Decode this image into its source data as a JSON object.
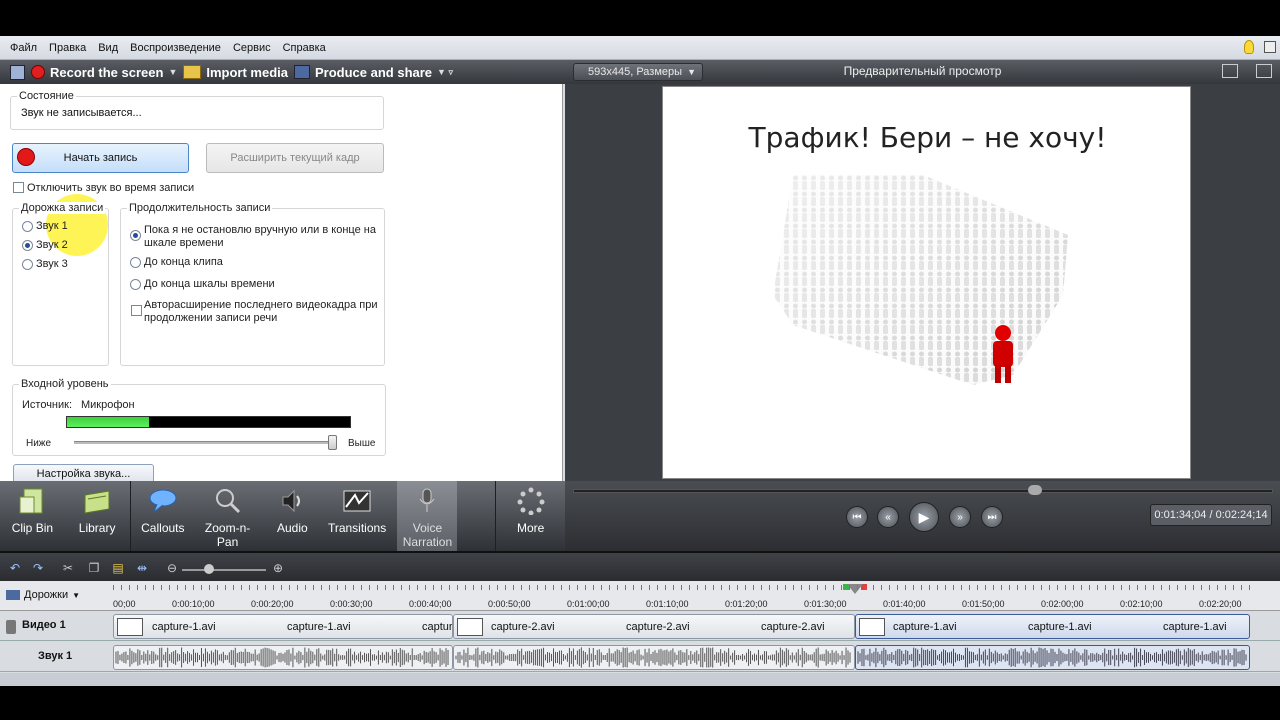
{
  "menu": [
    "Файл",
    "Правка",
    "Вид",
    "Воспроизведение",
    "Сервис",
    "Справка"
  ],
  "toolbar": {
    "record": "Record the screen",
    "import": "Import media",
    "produce": "Produce and share"
  },
  "voice_panel": {
    "status_legend": "Состояние",
    "status_text": "Звук не записывается...",
    "start_button": "Начать запись",
    "extend_button": "Расширить текущий кадр",
    "mute_checkbox": "Отключить звук во время записи",
    "track_legend": "Дорожка записи",
    "tracks": [
      "Звук 1",
      "Звук 2",
      "Звук 3"
    ],
    "selected_track": "Звук 2",
    "duration_legend": "Продолжительность записи",
    "duration_options": [
      "Пока я не остановлю вручную или в конце на шкале времени",
      "До конца клипа",
      "До конца шкалы времени"
    ],
    "autoextend": "Авторасширение последнего видеокадра при продолжении записи речи",
    "input_legend": "Входной уровень",
    "source_label": "Источник:",
    "source_value": "Микрофон",
    "level_fraction": 0.29,
    "low_label": "Ниже",
    "high_label": "Выше",
    "volume_fraction": 0.99,
    "settings_button": "Настройка звука..."
  },
  "tool_tabs": [
    {
      "label": "Clip Bin",
      "icon": "clip-bin-icon"
    },
    {
      "label": "Library",
      "icon": "library-icon"
    },
    {
      "label": "Callouts",
      "icon": "callouts-icon"
    },
    {
      "label": "Zoom-n-Pan",
      "icon": "zoom-icon"
    },
    {
      "label": "Audio",
      "icon": "speaker-icon"
    },
    {
      "label": "Transitions",
      "icon": "transitions-icon"
    },
    {
      "label": "Voice Narration",
      "icon": "microphone-icon"
    },
    {
      "label": "More",
      "icon": "more-icon"
    }
  ],
  "preview": {
    "size_dropdown": "593x445, Размеры",
    "title": "Предварительный просмотр",
    "slide_title": "Трафик! Бери – не хочу!",
    "timecode": "0:01:34;04 / 0:02:24;14",
    "position_fraction": 0.65
  },
  "timeline": {
    "tracks_label": "Дорожки",
    "ticks": [
      "00;00",
      "0:00:10;00",
      "0:00:20;00",
      "0:00:30;00",
      "0:00:40;00",
      "0:00:50;00",
      "0:01:00;00",
      "0:01:10;00",
      "0:01:20;00",
      "0:01:30;00",
      "0:01:40;00",
      "0:01:50;00",
      "0:02:00;00",
      "0:02:10;00",
      "0:02:20;00"
    ],
    "video_track": "Видео 1",
    "audio_track": "Звук 1",
    "clips": [
      {
        "labels": [
          "capture-1.avi",
          "capture-1.avi",
          "captur"
        ]
      },
      {
        "labels": [
          "capture-2.avi",
          "capture-2.avi",
          "capture-2.avi"
        ]
      },
      {
        "labels": [
          "capture-1.avi",
          "capture-1.avi",
          "capture-1.avi"
        ]
      }
    ]
  },
  "colors": {
    "accent": "#4a86c8",
    "record_red": "#e31919",
    "meter_green": "#3cd23c"
  }
}
